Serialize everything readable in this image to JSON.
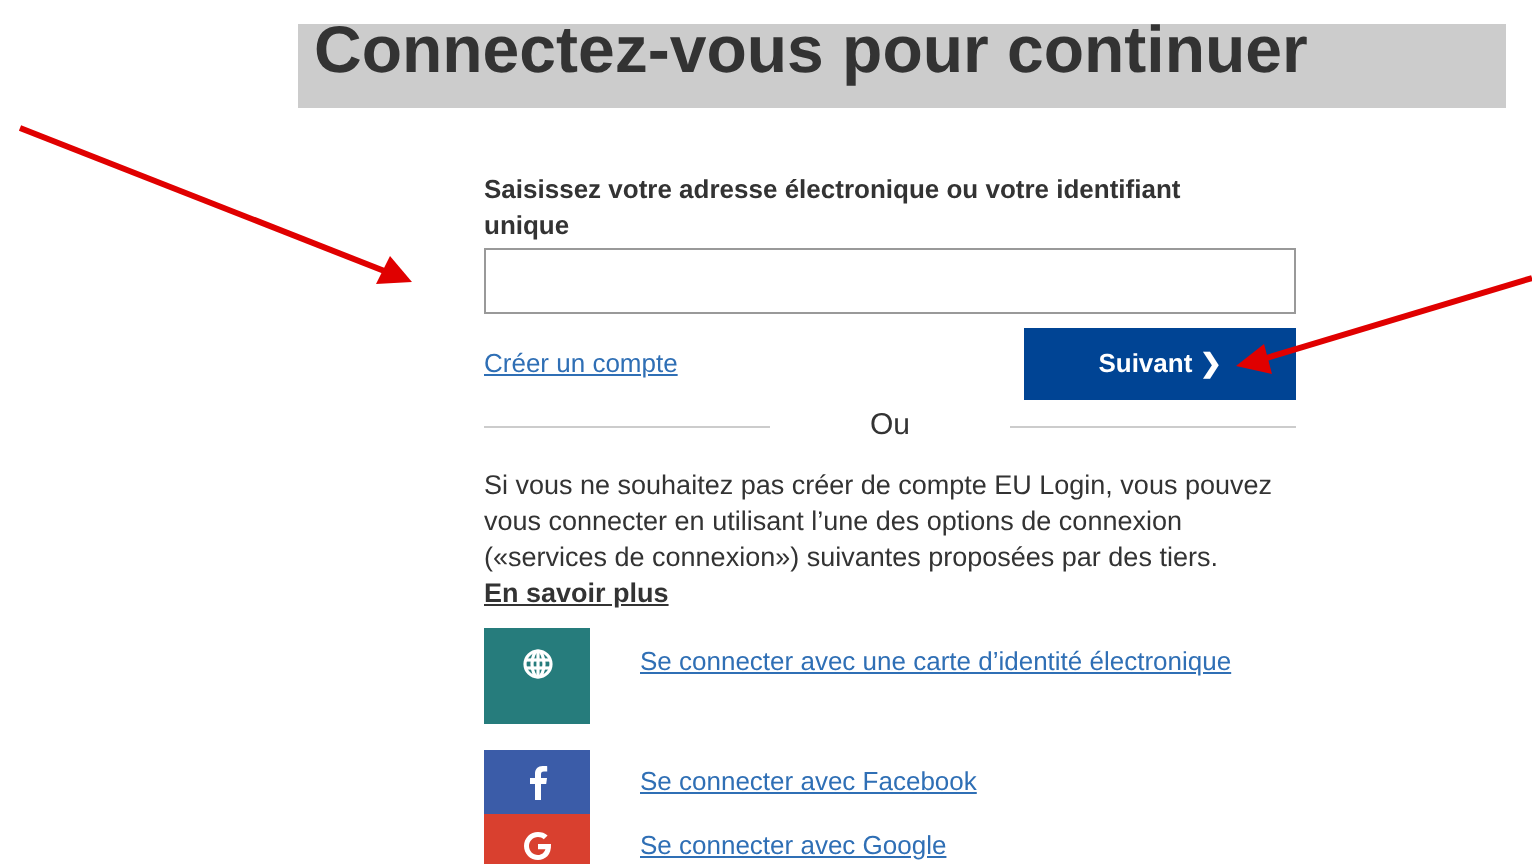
{
  "heading": "Connectez-vous pour continuer",
  "form": {
    "label": "Saisissez votre adresse électronique ou votre identifiant unique",
    "create_link": "Créer un compte",
    "next_button": "Suivant ❯",
    "separator": "Ou"
  },
  "intro": {
    "text": "Si vous ne souhaitez pas créer de compte EU Login, vous pouvez vous connecter en utilisant l’une des options de connexion («services de connexion») suivantes proposées par des tiers.",
    "link": "En savoir plus"
  },
  "providers": [
    {
      "kind": "eid",
      "color": "#267c7c",
      "label": "Se connecter avec une carte d’identité électronique"
    },
    {
      "kind": "facebook",
      "color": "#3b5ca8",
      "label": "Se connecter avec Facebook"
    },
    {
      "kind": "google",
      "color": "#d9402f",
      "label": "Se connecter avec Google"
    }
  ]
}
